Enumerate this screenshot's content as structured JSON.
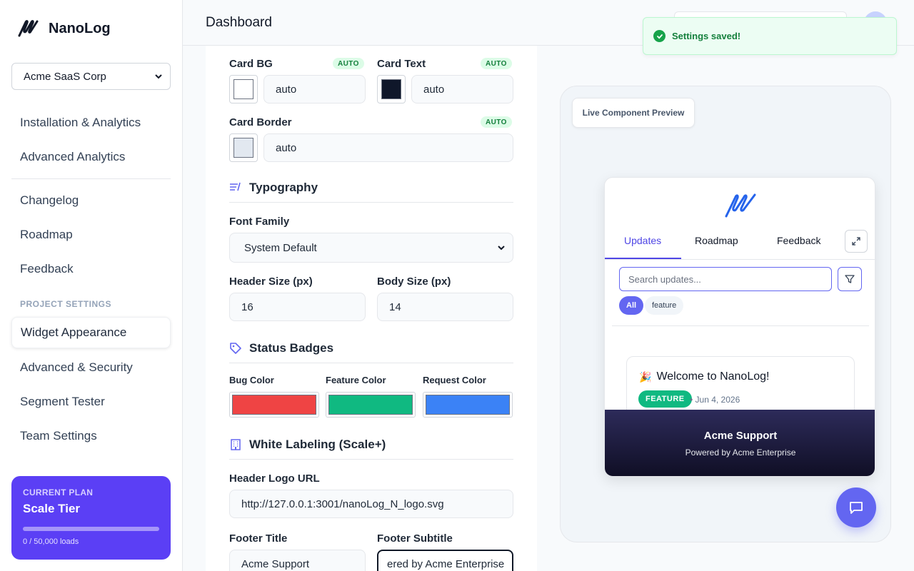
{
  "brand": {
    "name": "NanoLog"
  },
  "org_select": {
    "value": "Acme SaaS Corp"
  },
  "nav": {
    "items": [
      {
        "label": "Installation & Analytics"
      },
      {
        "label": "Advanced Analytics"
      },
      {
        "label": "Changelog"
      },
      {
        "label": "Roadmap"
      },
      {
        "label": "Feedback"
      },
      {
        "label": "Widget Appearance"
      },
      {
        "label": "Advanced & Security"
      },
      {
        "label": "Segment Tester"
      },
      {
        "label": "Team Settings"
      }
    ],
    "section_label": "PROJECT SETTINGS",
    "active": "Widget Appearance"
  },
  "plan": {
    "label": "CURRENT PLAN",
    "name": "Scale Tier",
    "usage": "0 / 50,000 loads",
    "usage_fraction": 0
  },
  "header": {
    "title": "Dashboard"
  },
  "toast": {
    "text": "Settings saved!"
  },
  "colors_section": {
    "card_bg": {
      "label": "Card BG",
      "badge": "AUTO",
      "value": "auto",
      "swatch": "#ffffff"
    },
    "card_text": {
      "label": "Card Text",
      "badge": "AUTO",
      "value": "auto",
      "swatch": "#0f172a"
    },
    "card_border": {
      "label": "Card Border",
      "badge": "AUTO",
      "value": "auto",
      "swatch": "#e2e8f0"
    }
  },
  "typography": {
    "title": "Typography",
    "font_family_label": "Font Family",
    "font_family_value": "System Default",
    "header_size_label": "Header Size (px)",
    "header_size_value": "16",
    "body_size_label": "Body Size (px)",
    "body_size_value": "14"
  },
  "status_badges": {
    "title": "Status Badges",
    "items": [
      {
        "label": "Bug Color",
        "color": "#ef4444"
      },
      {
        "label": "Feature Color",
        "color": "#10b981"
      },
      {
        "label": "Request Color",
        "color": "#3b82f6"
      }
    ]
  },
  "white_labeling": {
    "title": "White Labeling (Scale+)",
    "logo_label": "Header Logo URL",
    "logo_value": "http://127.0.0.1:3001/nanoLog_N_logo.svg",
    "footer_title_label": "Footer Title",
    "footer_title_value": "Acme Support",
    "footer_subtitle_label": "Footer Subtitle",
    "footer_subtitle_value": "ered by Acme Enterprise"
  },
  "preview": {
    "label": "Live Component Preview",
    "tabs": [
      "Updates",
      "Roadmap",
      "Feedback"
    ],
    "search_placeholder": "Search updates...",
    "chips": [
      "All",
      "feature"
    ],
    "update": {
      "emoji": "🎉",
      "title": "Welcome to NanoLog!",
      "badge": "FEATURE",
      "date": "• Jun 4, 2026"
    },
    "footer_title": "Acme Support",
    "footer_subtitle": "Powered by Acme Enterprise"
  },
  "accent": "#5b3ff5"
}
